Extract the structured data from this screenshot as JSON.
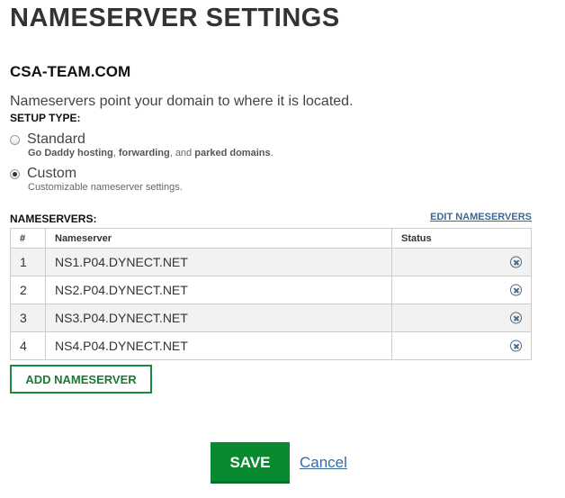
{
  "page": {
    "title": "NAMESERVER SETTINGS",
    "domain": "CSA-TEAM.COM",
    "intro": "Nameservers point your domain to where it is located."
  },
  "setup": {
    "label": "SETUP TYPE:",
    "options": [
      {
        "label": "Standard",
        "checked": false,
        "desc": [
          "Go Daddy hosting",
          ", ",
          "forwarding",
          ", and ",
          "parked domains",
          "."
        ]
      },
      {
        "label": "Custom",
        "checked": true,
        "desc_text": "Customizable nameserver settings."
      }
    ]
  },
  "nameservers": {
    "label": "NAMESERVERS:",
    "edit_link": "EDIT NAMESERVERS",
    "columns": [
      "#",
      "Nameserver",
      "Status"
    ],
    "rows": [
      {
        "num": "1",
        "name": "NS1.P04.DYNECT.NET",
        "status": ""
      },
      {
        "num": "2",
        "name": "NS2.P04.DYNECT.NET",
        "status": ""
      },
      {
        "num": "3",
        "name": "NS3.P04.DYNECT.NET",
        "status": ""
      },
      {
        "num": "4",
        "name": "NS4.P04.DYNECT.NET",
        "status": ""
      }
    ],
    "remove_icon": "remove-circle-icon"
  },
  "actions": {
    "add_label": "ADD NAMESERVER",
    "save_label": "SAVE",
    "cancel_label": "Cancel"
  },
  "colors": {
    "primary_green": "#0a8a2e",
    "link_blue": "#3a6a9c"
  }
}
